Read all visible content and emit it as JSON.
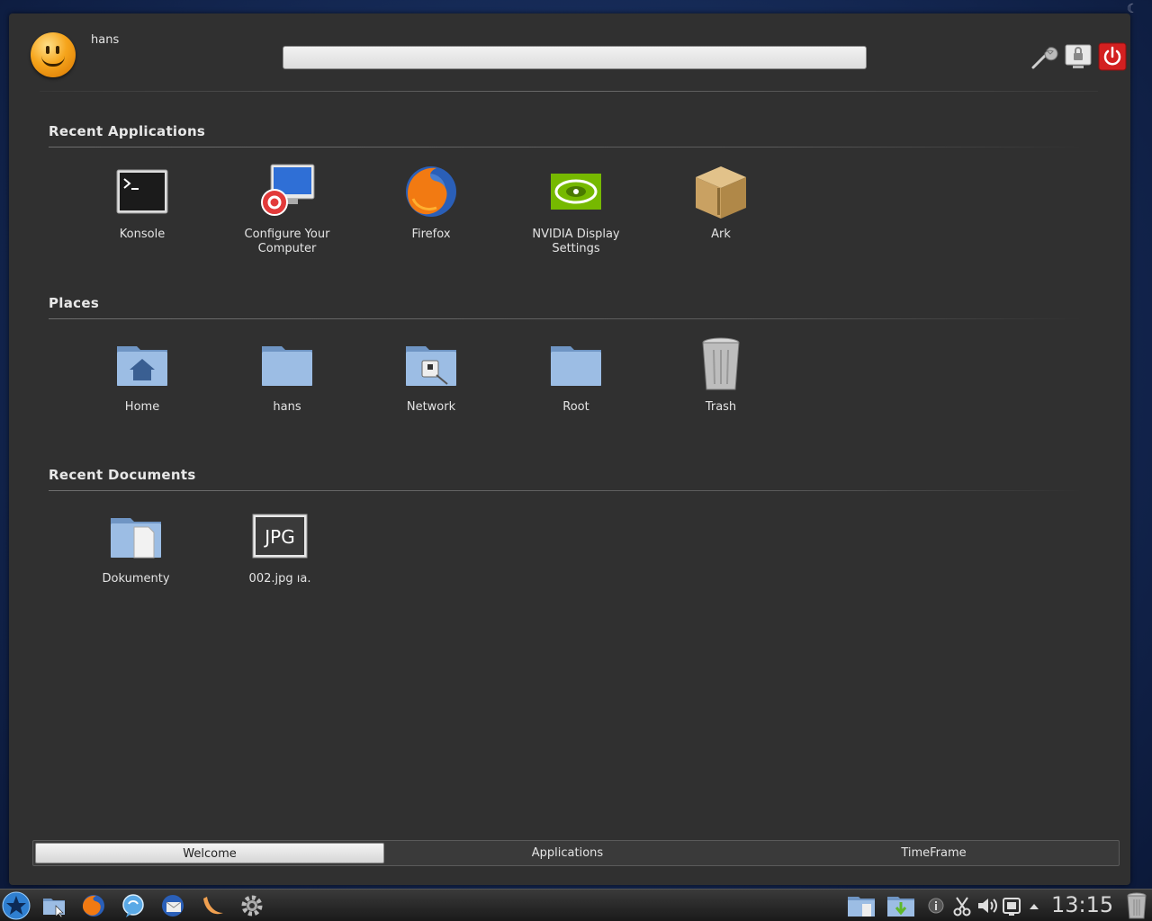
{
  "user": {
    "name": "hans"
  },
  "search": {
    "placeholder": ""
  },
  "sections": {
    "recent_apps": {
      "title": "Recent Applications",
      "items": [
        {
          "label": "Konsole"
        },
        {
          "label": "Configure Your Computer"
        },
        {
          "label": "Firefox"
        },
        {
          "label": "NVIDIA Display Settings"
        },
        {
          "label": "Ark"
        }
      ]
    },
    "places": {
      "title": "Places",
      "items": [
        {
          "label": "Home"
        },
        {
          "label": "hans"
        },
        {
          "label": "Network"
        },
        {
          "label": "Root"
        },
        {
          "label": "Trash"
        }
      ]
    },
    "recent_docs": {
      "title": "Recent Documents",
      "items": [
        {
          "label": "Dokumenty"
        },
        {
          "label": "002.jpg  ıa."
        }
      ]
    }
  },
  "jpg_badge": "JPG",
  "tabs": [
    {
      "label": "Welcome",
      "active": true
    },
    {
      "label": "Applications"
    },
    {
      "label": "TimeFrame"
    }
  ],
  "taskbar": {
    "clock": "13:15"
  },
  "colors": {
    "accent_blue": "#1f3a6e",
    "panel": "#303030",
    "power_red": "#d32020",
    "nvidia_green": "#76b900"
  }
}
